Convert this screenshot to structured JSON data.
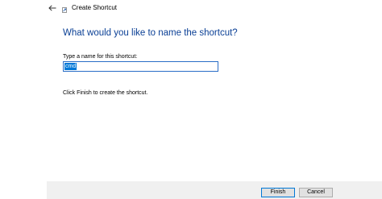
{
  "window": {
    "title": "Create Shortcut",
    "back_icon": "back-arrow-icon",
    "app_icon": "shortcut-icon"
  },
  "main": {
    "heading": "What would you like to name the shortcut?",
    "name_label": "Type a name for this shortcut:",
    "name_value": "cmd",
    "hint": "Click Finish to create the shortcut."
  },
  "footer": {
    "finish_label": "Finish",
    "cancel_label": "Cancel"
  },
  "colors": {
    "heading": "#0a3f95",
    "selection": "#0078d7",
    "input_border": "#2a6ec7",
    "footer_bg": "#f0f0f0"
  }
}
